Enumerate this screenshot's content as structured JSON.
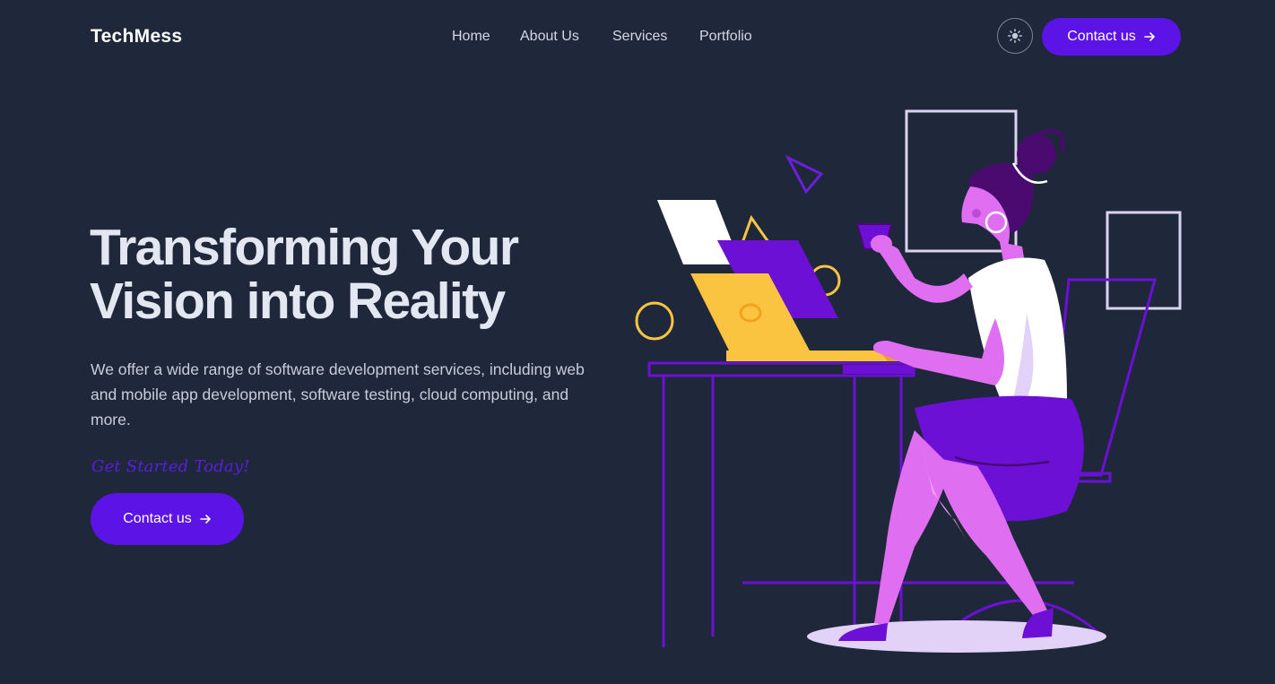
{
  "header": {
    "brand": "TechMess",
    "nav": [
      {
        "label": "Home"
      },
      {
        "label": "About Us"
      },
      {
        "label": "Services"
      },
      {
        "label": "Portfolio"
      }
    ],
    "theme_toggle_icon": "sun-icon",
    "contact_label": "Contact us"
  },
  "hero": {
    "title_line1": "Transforming Your",
    "title_line2": "Vision into Reality",
    "description": "We offer a wide range of software development services, including web and mobile app development, software testing, cloud computing, and more.",
    "tagline": "Get Started Today!",
    "cta_label": "Contact us",
    "cta_icon": "arrow-right-icon"
  },
  "colors": {
    "background": "#1f273b",
    "accent": "#5b13e6",
    "yellow": "#fbc440",
    "pink": "#e06ef0",
    "purple": "#6b0fd6"
  }
}
